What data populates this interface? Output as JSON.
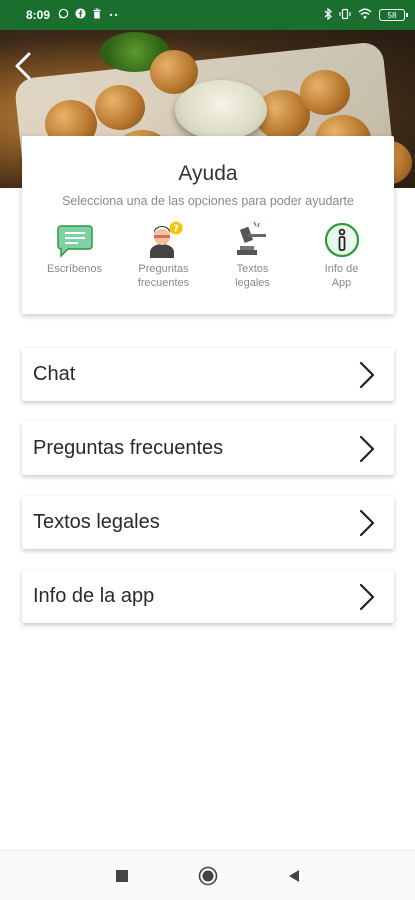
{
  "status_bar": {
    "time": "8:09",
    "left_icons": [
      "whatsapp-icon",
      "facebook-icon",
      "trash-icon",
      "more-dots-icon"
    ],
    "right_icons": [
      "bluetooth-icon",
      "vibrate-icon",
      "wifi-icon",
      "battery-icon"
    ],
    "battery": "58",
    "background_color": "#1b6f2e"
  },
  "header": {
    "back_icon": "chevron-left-icon"
  },
  "help_card": {
    "title": "Ayuda",
    "subtitle": "Selecciona una de las opciones para poder ayudarte",
    "options": [
      {
        "label_line1": "Escríbenos",
        "label_line2": "",
        "icon": "chat-bubble-icon"
      },
      {
        "label_line1": "Preguntas",
        "label_line2": "frecuentes",
        "icon": "person-question-icon"
      },
      {
        "label_line1": "Textos",
        "label_line2": "legales",
        "icon": "gavel-icon"
      },
      {
        "label_line1": "Info de",
        "label_line2": "App",
        "icon": "info-icon"
      }
    ],
    "accent_color": "#2e9a3a"
  },
  "menu": {
    "items": [
      {
        "label": "Chat"
      },
      {
        "label": "Preguntas frecuentes"
      },
      {
        "label": "Textos legales"
      },
      {
        "label": "Info de la app"
      }
    ]
  },
  "nav_bar": {
    "buttons": [
      "recent-apps-icon",
      "home-icon",
      "back-triangle-icon"
    ]
  }
}
